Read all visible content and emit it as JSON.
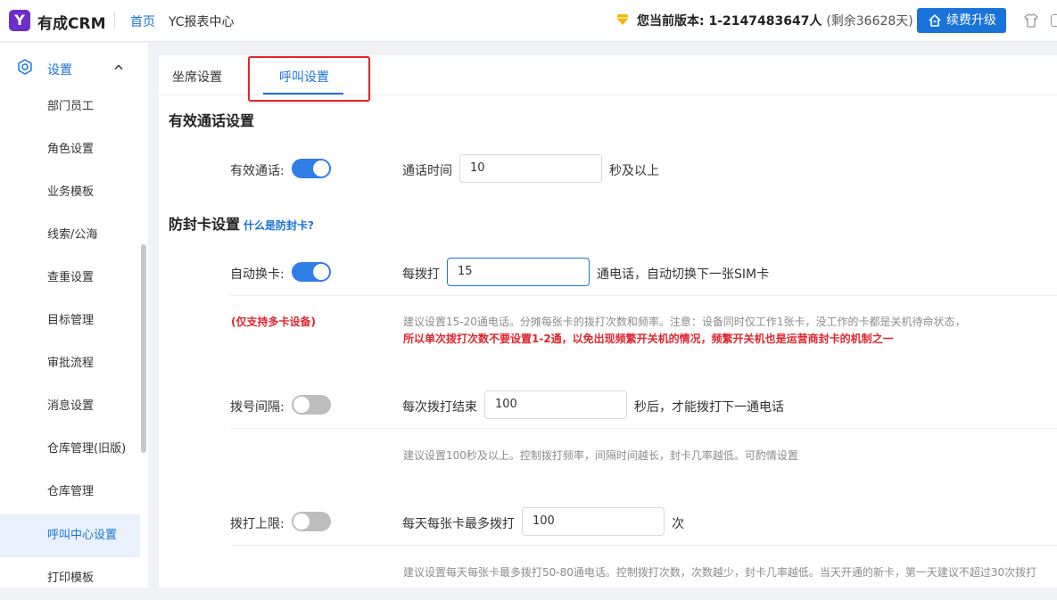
{
  "topbar": {
    "logo_letter": "Y",
    "brand": "有成CRM",
    "nav_home": "首页",
    "nav_report": "YC报表中心",
    "version_label": "您当前版本: 1-2147483647人",
    "version_remain": "(剩余36628天)",
    "upgrade_label": "续费升级"
  },
  "sidebar": {
    "section_label": "设置",
    "items": [
      "部门员工",
      "角色设置",
      "业务模板",
      "线索/公海",
      "查重设置",
      "目标管理",
      "审批流程",
      "消息设置",
      "仓库管理(旧版)",
      "仓库管理",
      "呼叫中心设置",
      "打印模板"
    ],
    "active_item": "呼叫中心设置"
  },
  "tabs": [
    "坐席设置",
    "呼叫设置"
  ],
  "active_tab": "呼叫设置",
  "valid_call": {
    "title": "有效通话设置",
    "toggle_label": "有效通话:",
    "toggle_on": true,
    "duration_prefix": "通话时间",
    "duration_value": "10",
    "duration_suffix": "秒及以上"
  },
  "anti_block": {
    "title": "防封卡设置",
    "help_link": "什么是防封卡?",
    "auto_switch": {
      "label": "自动换卡:",
      "toggle_on": true,
      "prefix": "每拨打",
      "value": "15",
      "suffix": "通电话，自动切换下一张SIM卡",
      "note_red": "(仅支持多卡设备)",
      "hint": "建议设置15-20通电话。分摊每张卡的拨打次数和频率。注意：设备同时仅工作1张卡，没工作的卡都是关机待命状态，",
      "warn": "所以单次拨打次数不要设置1-2通，以免出现频繁开关机的情况，频繁开关机也是运营商封卡的机制之一"
    },
    "dial_interval": {
      "label": "拨号间隔:",
      "toggle_on": false,
      "prefix": "每次拨打结束",
      "value": "100",
      "suffix": "秒后，才能拨打下一通电话",
      "hint": "建议设置100秒及以上。控制拨打频率，间隔时间越长，封卡几率越低。可酌情设置"
    },
    "dial_limit": {
      "label": "拨打上限:",
      "toggle_on": false,
      "prefix": "每天每张卡最多拨打",
      "value": "100",
      "suffix": "次",
      "hint": "建议设置每天每张卡最多拨打50-80通电话。控制拨打次数，次数越少，封卡几率越低。当天开通的新卡，第一天建议不超过30次拨打"
    }
  },
  "colors": {
    "accent": "#1a73d9",
    "warn": "#e0262e",
    "toggle_on": "#2f7ee6",
    "toggle_off": "#bdbdbd"
  }
}
